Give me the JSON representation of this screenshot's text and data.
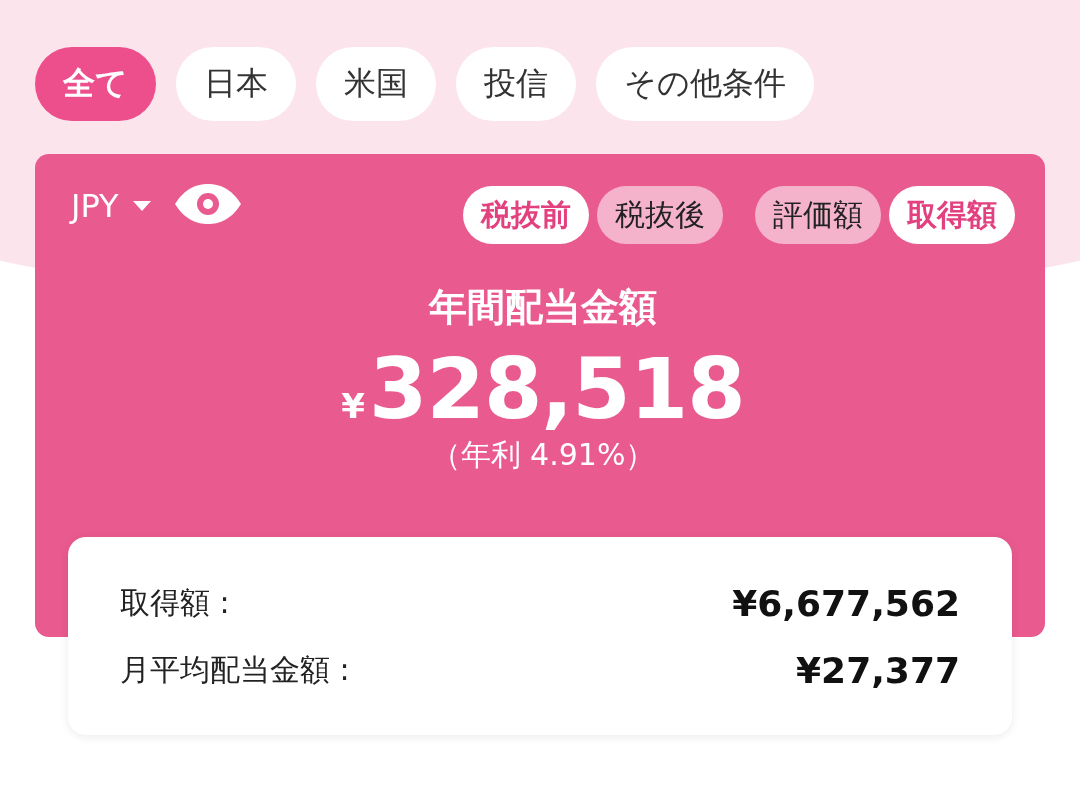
{
  "filters": [
    {
      "label": "全て",
      "selected": true
    },
    {
      "label": "日本",
      "selected": false
    },
    {
      "label": "米国",
      "selected": false
    },
    {
      "label": "投信",
      "selected": false
    },
    {
      "label": "その他条件",
      "selected": false
    }
  ],
  "card": {
    "currency": "JPY",
    "tax_toggle": [
      {
        "label": "税抜前",
        "selected": true
      },
      {
        "label": "税抜後",
        "selected": false
      }
    ],
    "basis_toggle": [
      {
        "label": "評価額",
        "selected": false
      },
      {
        "label": "取得額",
        "selected": true
      }
    ],
    "title": "年間配当金額",
    "amount": {
      "symbol": "¥",
      "value": "328,518"
    },
    "yield": "（年利 4.91%）"
  },
  "summary": [
    {
      "label": "取得額 :",
      "value": "¥6,677,562"
    },
    {
      "label": "月平均配当金額 :",
      "value": "¥27,377"
    }
  ]
}
